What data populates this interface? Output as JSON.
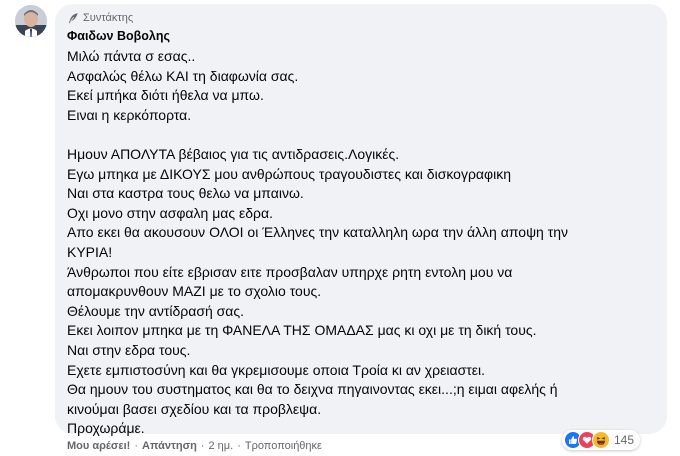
{
  "comment": {
    "role_label": "Συντάκτης",
    "author": "Φαιδων Βοβολης",
    "lines": [
      "Μιλώ πάντα σ εσας..",
      "Ασφαλώς θέλω ΚΑΙ τη διαφωνία σας.",
      "Εκεί μπήκα διότι ήθελα να μπω.",
      "Ειναι η κερκόπορτα.",
      "",
      "Ημουν ΑΠΟΛΥΤΑ βέβαιος για τις αντιδρασεις.Λογικές.",
      "Εγω μπηκα με ΔΙΚΟΥΣ μου ανθρώπους τραγουδιστες και δισκογραφικη",
      "Ναι στα καστρα τους θελω να μπαινω.",
      "Οχι μονο στην ασφαλη μας εδρα.",
      "Απο εκει θα ακουσουν ΟΛΟΙ οι Έλληνες την καταλληλη ωρα την άλλη αποψη την",
      "ΚΥΡΙΑ!",
      "Άνθρωποι που είτε εβρισαν ειτε προσβαλαν υπηρχε ρητη εντολη μου να",
      "απομακρυνθουν ΜΑΖΙ με το σχολιο τους.",
      "Θέλουμε την αντίδρασή σας.",
      "Εκει λοιπον μπηκα με τη ΦΑΝΕΛΑ ΤΗΣ ΟΜΑΔΑΣ μας κι οχι με τη δική τους.",
      "Ναι στην εδρα τους.",
      "Εχετε εμπιστοσύνη και θα γκρεμισουμε οποια Τροία κι αν χρειαστει.",
      "Θα ημουν του συστηματος και θα το δειχνα πηγαινοντας εκει...;η ειμαι αφελής ή",
      "κινούμαι βασει σχεδίου και τα προβλεψα.",
      "Προχωράμε."
    ]
  },
  "actions": {
    "like": "Μου αρέσει!",
    "reply": "Απάντηση",
    "time": "2 ημ.",
    "edited": "Τροποποιήθηκε",
    "separator": "·"
  },
  "reactions": {
    "icons": [
      "like-icon",
      "love-icon",
      "haha-icon"
    ],
    "count": "145"
  },
  "colors": {
    "bubble_bg": "#f0f2f5",
    "text": "#050505",
    "secondary": "#65676b",
    "like_blue": "#1877f2",
    "love_red": "#f33e58",
    "haha_yellow": "#f7b928"
  }
}
